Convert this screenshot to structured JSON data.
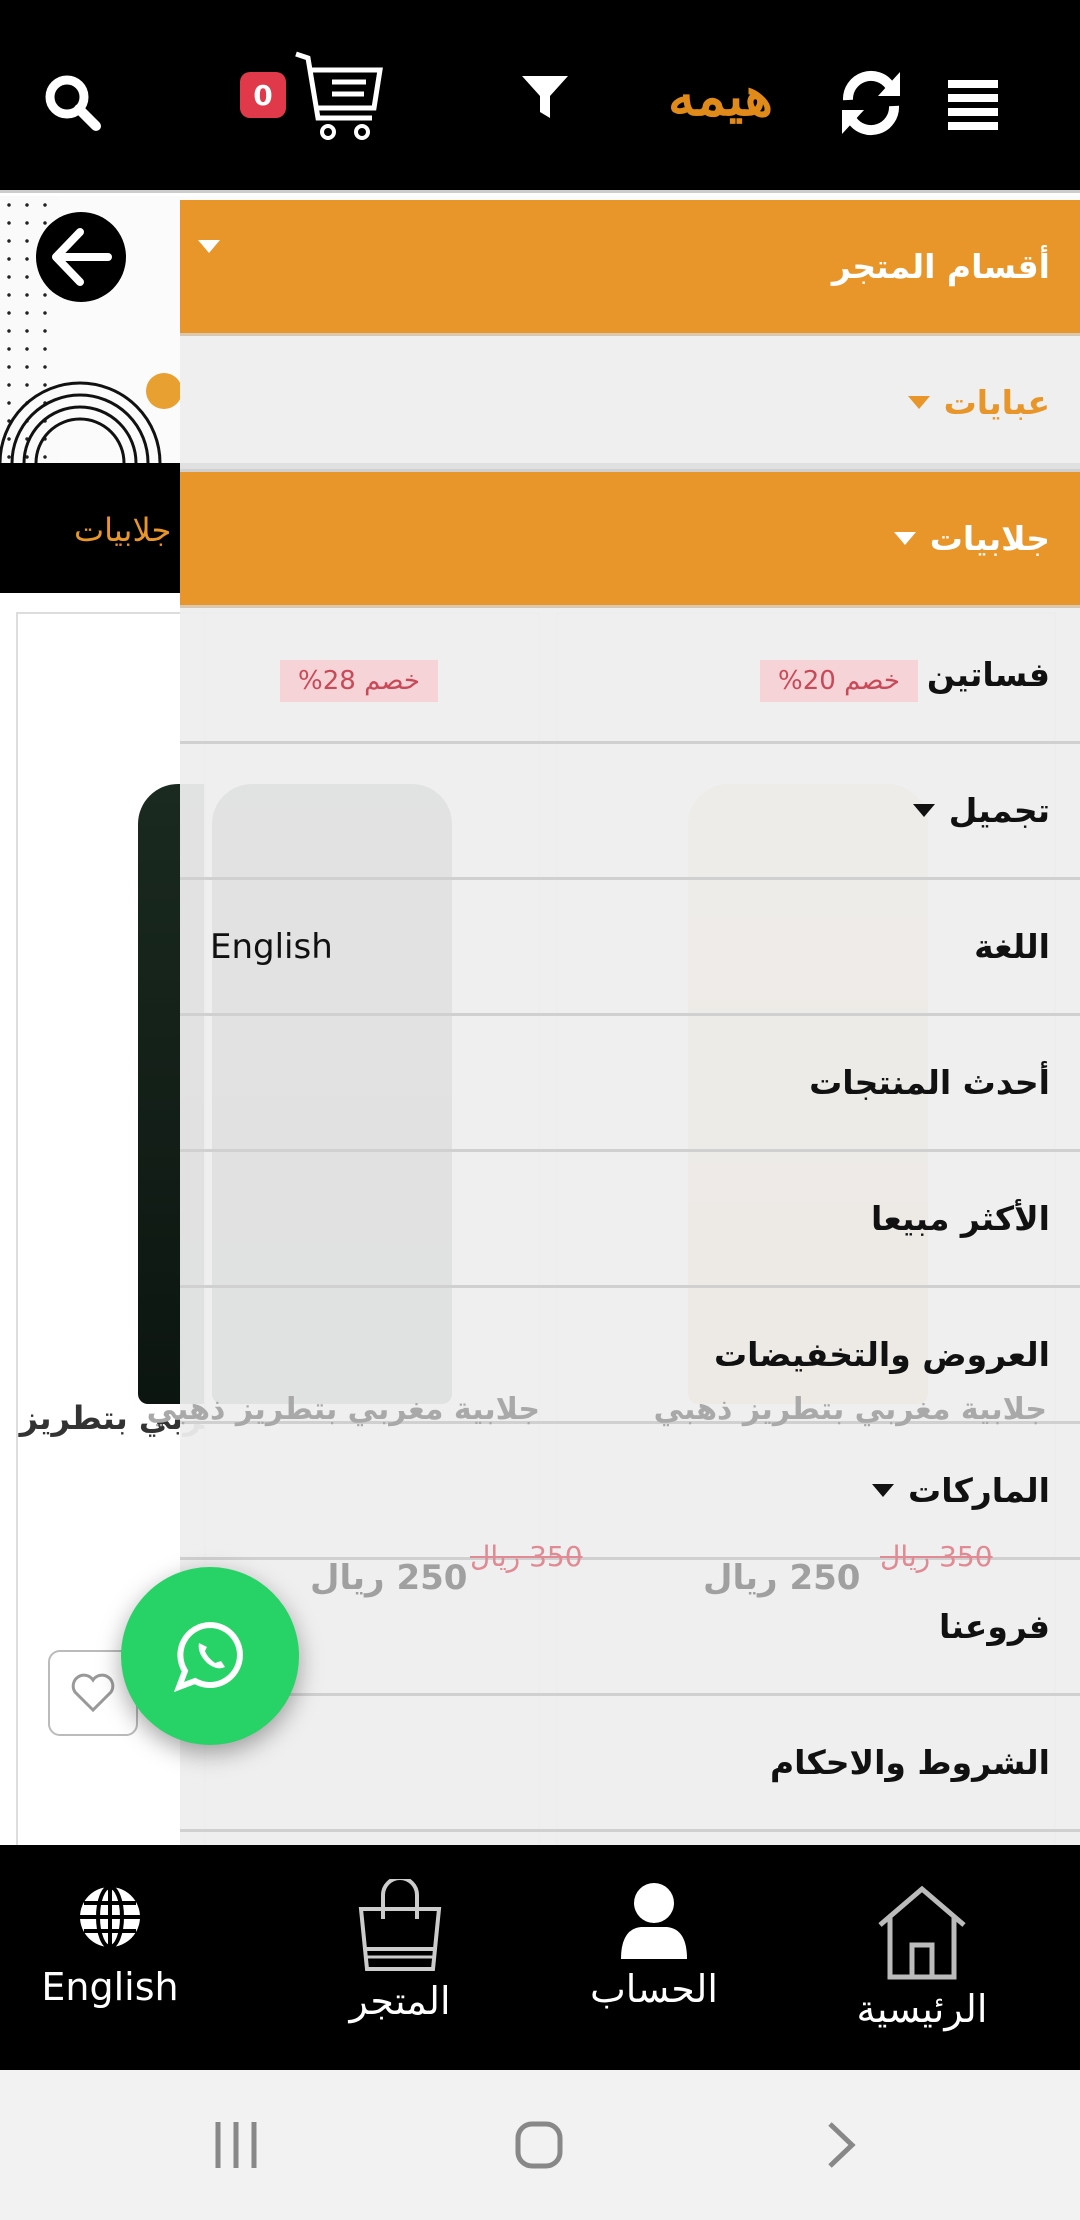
{
  "header": {
    "cart_count": "0",
    "logo_text": "هيمه",
    "icons": [
      "search-icon",
      "cart-icon",
      "filter-icon",
      "refresh-icon",
      "menu-icon"
    ]
  },
  "page": {
    "category_strip": "جلابيات",
    "products": [
      {
        "title": "جلابية مغربي بتطريز ذهبي",
        "discount": "خصم 20%",
        "price": "250 ريال",
        "old_price": "350 ريال"
      },
      {
        "title": "جلابية مغربي بتطريز ذهبي",
        "discount": "خصم 28%",
        "price": "250 ريال",
        "old_price": "350 ريال"
      },
      {
        "title": "جلابية مغربي بتطريز ذهبي"
      }
    ]
  },
  "drawer": {
    "header": "أقسام المتجر",
    "items": [
      {
        "label": "عبايات",
        "has_caret": true
      },
      {
        "label": "جلابيات",
        "has_caret": true
      },
      {
        "label": "فساتين",
        "has_caret": true
      },
      {
        "label": "تجميل",
        "has_caret": true
      },
      {
        "label": "اللغة",
        "value": "English"
      },
      {
        "label": "أحدث المنتجات"
      },
      {
        "label": "الأكثر مبيعا"
      },
      {
        "label": "العروض والتخفيضات"
      },
      {
        "label": "الماركات",
        "has_caret": true
      },
      {
        "label": "فروعنا"
      },
      {
        "label": "الشروط والاحكام"
      }
    ]
  },
  "bottom_nav": {
    "english": "English",
    "store": "المتجر",
    "account": "الحساب",
    "home": "الرئيسية"
  },
  "colors": {
    "accent": "#e8962a",
    "badge": "#e03a4a",
    "whatsapp": "#27d366",
    "bar": "#000000"
  }
}
